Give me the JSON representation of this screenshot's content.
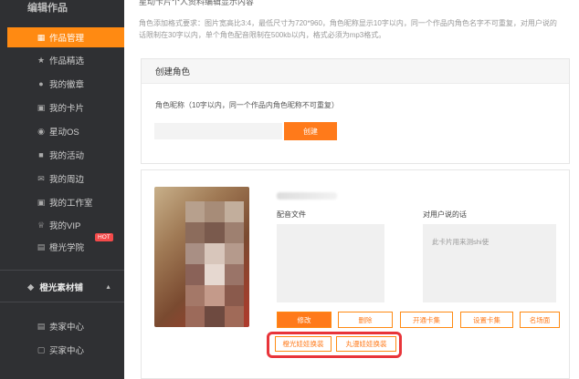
{
  "sidebar": {
    "top_label": "编辑作品",
    "items": [
      {
        "label": "作品管理",
        "icon": "grid-icon"
      },
      {
        "label": "作品精选",
        "icon": "star-icon"
      },
      {
        "label": "我的徽章",
        "icon": "badge-icon"
      },
      {
        "label": "我的卡片",
        "icon": "card-icon"
      },
      {
        "label": "星动OS",
        "icon": "os-icon"
      },
      {
        "label": "我的活动",
        "icon": "activity-icon"
      },
      {
        "label": "我的周边",
        "icon": "mail-icon"
      },
      {
        "label": "我的工作室",
        "icon": "studio-icon"
      },
      {
        "label": "我的VIP",
        "icon": "crown-icon"
      },
      {
        "label": "橙光学院",
        "icon": "school-icon"
      }
    ],
    "hot_badge": "HOT",
    "section_title": "橙光素材铺",
    "section_items": [
      {
        "label": "卖家中心",
        "icon": "seller-icon"
      },
      {
        "label": "买家中心",
        "icon": "buyer-icon"
      }
    ]
  },
  "main": {
    "top_cut_text": "星动卡片个人资料编辑显示内容",
    "requirements": "角色添加格式要求：图片宽高比3:4，最低尺寸为720*960，角色昵称显示10字以内，同一个作品内角色名字不可重复，对用户说的话限制在30字以内，单个角色配音限制在500kb以内，格式必须为mp3格式。",
    "create_card": {
      "title": "创建角色",
      "label": "角色昵称（10字以内，同一个作品内角色昵称不可重复）",
      "input_value": "",
      "create_button": "创建"
    },
    "role_card": {
      "dub_label": "配音文件",
      "say_label": "对用户说的话",
      "say_text": "此卡片用来测shi使",
      "buttons": [
        "修改",
        "删除",
        "开通卡集",
        "设置卡集",
        "名场面"
      ],
      "buttons_row2": [
        "橙光娃娃换装",
        "丸漫娃娃换装"
      ]
    }
  },
  "colors": {
    "accent": "#ff7a1a",
    "sidebar_bg": "#2f3033",
    "highlight": "#e8353a"
  }
}
